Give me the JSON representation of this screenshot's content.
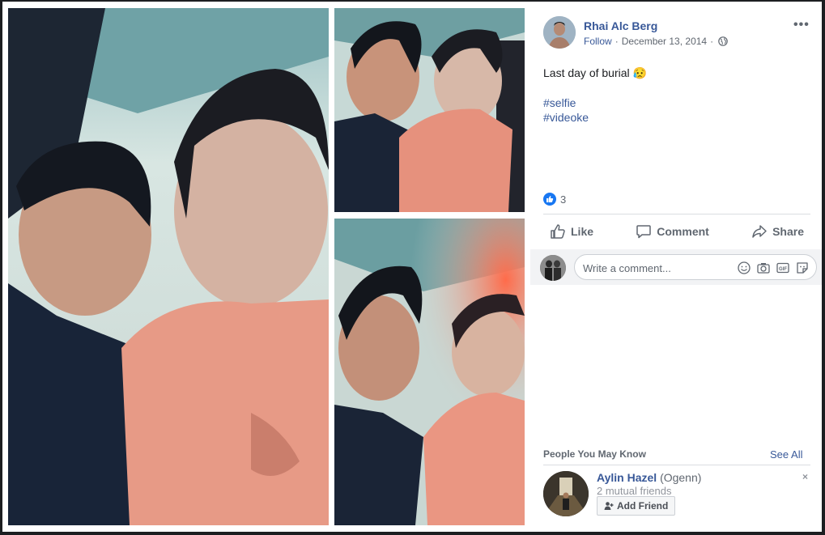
{
  "post": {
    "author": "Rhai Alc Berg",
    "follow_label": "Follow",
    "separator": "·",
    "date": "December 13, 2014",
    "text": "Last day of burial 😥",
    "hashtags": [
      "#selfie",
      "#videoke"
    ],
    "reaction_count": "3",
    "more_icon": "more-horizontal-icon",
    "privacy_icon": "globe-icon"
  },
  "actions": {
    "like": "Like",
    "comment": "Comment",
    "share": "Share"
  },
  "comment_box": {
    "placeholder": "Write a comment..."
  },
  "pymk": {
    "title": "People You May Know",
    "see_all": "See All",
    "person": {
      "name": "Aylin Hazel",
      "alias": "(Ogenn)",
      "mutual": "2 mutual friends",
      "add_friend": "Add Friend",
      "dismiss": "×"
    }
  },
  "colors": {
    "link": "#385898",
    "like_blue": "#1877f2",
    "muted": "#606770"
  }
}
